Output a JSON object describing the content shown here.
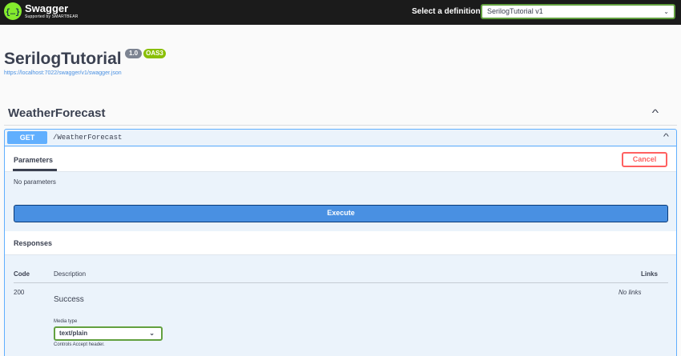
{
  "topbar": {
    "brand": "Swagger",
    "brand_sub": "Supported by SMARTBEAR",
    "definition_label": "Select a definition",
    "definition_value": "SerilogTutorial v1"
  },
  "info": {
    "title": "SerilogTutorial",
    "version_badge": "1.0",
    "oas_badge": "OAS3",
    "url": "https://localhost:7022/swagger/v1/swagger.json"
  },
  "tag": {
    "name": "WeatherForecast",
    "chevron": "^"
  },
  "operation": {
    "method": "GET",
    "path": "/WeatherForecast",
    "chevron": "^",
    "parameters_tab": "Parameters",
    "cancel_label": "Cancel",
    "no_params": "No parameters",
    "execute_label": "Execute",
    "responses_title": "Responses",
    "columns": {
      "code": "Code",
      "description": "Description",
      "links": "Links"
    },
    "responses": [
      {
        "code": "200",
        "description": "Success",
        "links": "No links",
        "media_type_label": "Media type",
        "media_type_value": "text/plain",
        "controls_note": "Controls Accept header."
      }
    ]
  },
  "colors": {
    "get_method": "#61affe",
    "execute": "#4990e2",
    "cancel": "#ff6060",
    "oas_badge": "#89bf04",
    "logo": "#85ea2d"
  }
}
